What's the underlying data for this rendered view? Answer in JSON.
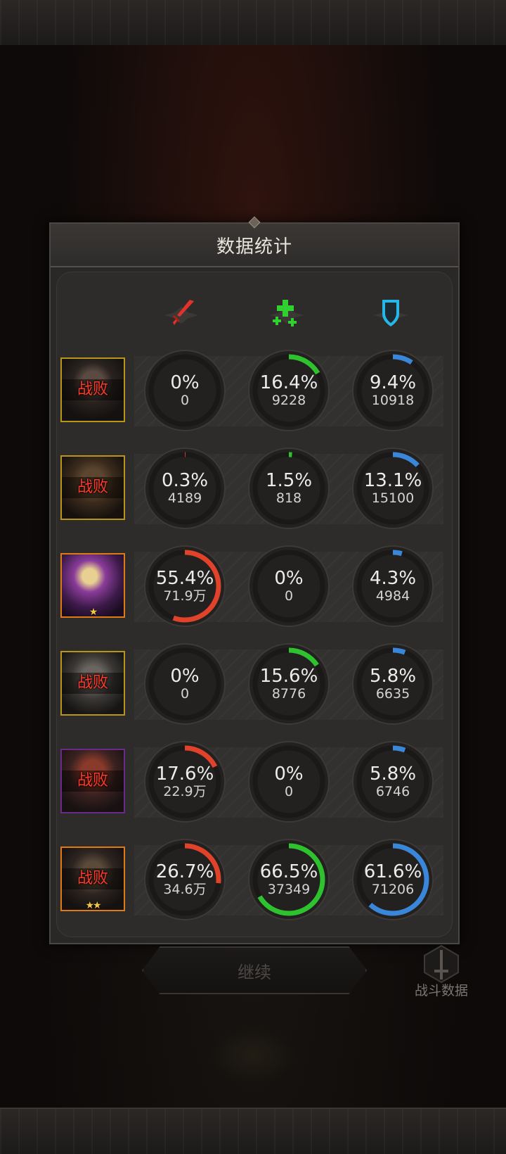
{
  "panel": {
    "title": "数据统计"
  },
  "columns": [
    {
      "icon": "red-sword-damage-icon"
    },
    {
      "icon": "green-cross-healing-icon"
    },
    {
      "icon": "blue-shield-defense-icon"
    }
  ],
  "avatar_label": "战败",
  "rows": [
    {
      "avatar_frame": "#b8961c",
      "defeated": true,
      "stars": "",
      "damage": {
        "pct": "0%",
        "val": "0",
        "fraction": 0.0
      },
      "heal": {
        "pct": "16.4%",
        "val": "9228",
        "fraction": 0.164
      },
      "defense": {
        "pct": "9.4%",
        "val": "10918",
        "fraction": 0.094
      }
    },
    {
      "avatar_frame": "#b8961c",
      "defeated": true,
      "stars": "",
      "damage": {
        "pct": "0.3%",
        "val": "4189",
        "fraction": 0.003
      },
      "heal": {
        "pct": "1.5%",
        "val": "818",
        "fraction": 0.015
      },
      "defense": {
        "pct": "13.1%",
        "val": "15100",
        "fraction": 0.131
      }
    },
    {
      "avatar_frame": "#e07a14",
      "defeated": false,
      "stars": "★",
      "damage": {
        "pct": "55.4%",
        "val": "71.9万",
        "fraction": 0.554
      },
      "heal": {
        "pct": "0%",
        "val": "0",
        "fraction": 0.0
      },
      "defense": {
        "pct": "4.3%",
        "val": "4984",
        "fraction": 0.043
      }
    },
    {
      "avatar_frame": "#b8961c",
      "defeated": true,
      "stars": "",
      "damage": {
        "pct": "0%",
        "val": "0",
        "fraction": 0.0
      },
      "heal": {
        "pct": "15.6%",
        "val": "8776",
        "fraction": 0.156
      },
      "defense": {
        "pct": "5.8%",
        "val": "6635",
        "fraction": 0.058
      }
    },
    {
      "avatar_frame": "#6a2a8a",
      "defeated": true,
      "stars": "",
      "damage": {
        "pct": "17.6%",
        "val": "22.9万",
        "fraction": 0.176
      },
      "heal": {
        "pct": "0%",
        "val": "0",
        "fraction": 0.0
      },
      "defense": {
        "pct": "5.8%",
        "val": "6746",
        "fraction": 0.058
      }
    },
    {
      "avatar_frame": "#e07a14",
      "defeated": true,
      "stars": "★★",
      "damage": {
        "pct": "26.7%",
        "val": "34.6万",
        "fraction": 0.267
      },
      "heal": {
        "pct": "66.5%",
        "val": "37349",
        "fraction": 0.665
      },
      "defense": {
        "pct": "61.6%",
        "val": "71206",
        "fraction": 0.616
      }
    }
  ],
  "ring_colors": {
    "damage": "#e0432a",
    "heal": "#2fc22f",
    "defense": "#3a86d8",
    "track": "#1a1918"
  },
  "continue_button": {
    "label": "继续"
  },
  "battle_data_button": {
    "label": "战斗数据"
  }
}
